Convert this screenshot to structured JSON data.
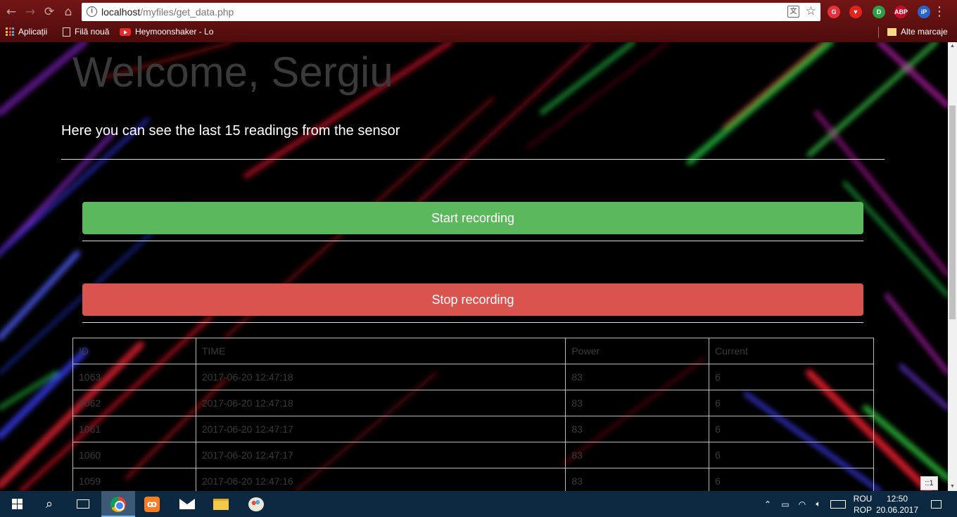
{
  "browser": {
    "url_host": "localhost",
    "url_path": "/myfiles/get_data.php",
    "nav_back_glyph": "←",
    "nav_forward_glyph": "→",
    "nav_reload_glyph": "⟳",
    "nav_home_glyph": "⌂",
    "extensions": [
      {
        "icon": "grammarly-icon",
        "label": "G",
        "color": "#e6313c"
      },
      {
        "icon": "shield-icon",
        "label": "▼",
        "color": "#e0261c"
      },
      {
        "icon": "green-extension-icon",
        "label": "D",
        "color": "#2f9e4a"
      },
      {
        "icon": "adblock-plus-icon",
        "label": "ABP",
        "color": "#c70d2c"
      },
      {
        "icon": "ip-icon",
        "label": "iP",
        "color": "#2b64c8"
      }
    ],
    "bookmarks": {
      "apps_label": "Aplicații",
      "new_file_label": "Filă nouă",
      "youtube_label": "Heymoonshaker - Lo",
      "other_label": "Alte marcaje"
    }
  },
  "page": {
    "welcome": "Welcome, Sergiu",
    "subtitle": "Here you can see the last 15 readings from the sensor",
    "start_button": "Start recording",
    "stop_button": "Stop recording",
    "colors": {
      "start": "#5cb85c",
      "stop": "#d9534f"
    },
    "table": {
      "headers": [
        "ID",
        "TIME",
        "Power",
        "Current"
      ],
      "rows": [
        [
          "1063",
          "2017-06-20 12:47:18",
          "83",
          "6"
        ],
        [
          "1062",
          "2017-06-20 12:47:18",
          "83",
          "6"
        ],
        [
          "1061",
          "2017-06-20 12:47:17",
          "83",
          "6"
        ],
        [
          "1060",
          "2017-06-20 12:47:17",
          "83",
          "6"
        ],
        [
          "1059",
          "2017-06-20 12:47:16",
          "83",
          "6"
        ]
      ]
    },
    "zoom_chip": "::1"
  },
  "taskbar": {
    "apps": [
      "windows-start-icon",
      "search-icon",
      "task-view-icon",
      "chrome-icon",
      "xampp-icon",
      "mail-icon",
      "file-explorer-icon",
      "paint-icon"
    ],
    "lang_top": "ROU",
    "lang_bottom": "ROP",
    "time": "12:50",
    "date": "20.06.2017"
  }
}
